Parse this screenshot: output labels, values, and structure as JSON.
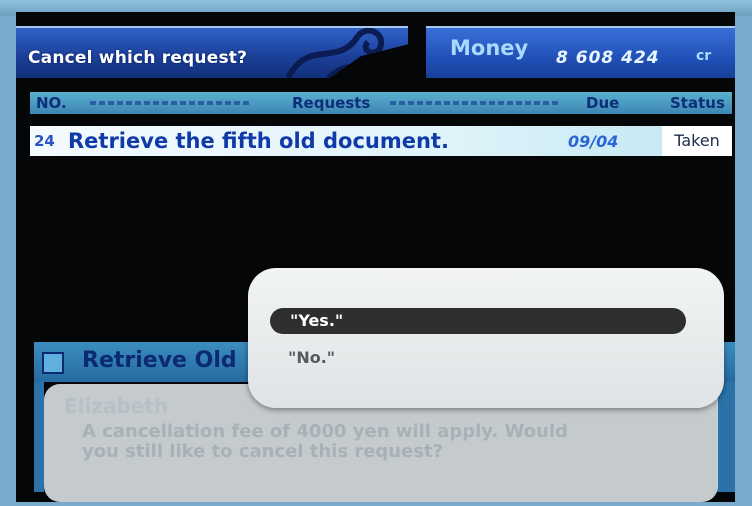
{
  "header": {
    "prompt": "Cancel which request?",
    "money_label": "Money",
    "money_value": "8 608 424",
    "money_unit": "cr"
  },
  "table": {
    "columns": [
      "NO.",
      "Requests",
      "Due",
      "Status"
    ],
    "rows": [
      {
        "no": "24",
        "request": "Retrieve the fifth old document.",
        "due": "09/04",
        "status": "Taken"
      }
    ]
  },
  "detail": {
    "title": "Retrieve Old"
  },
  "message": {
    "speaker": "Elizabeth",
    "text": "A cancellation fee of 4000 yen will apply. Would you still like to cancel this request?"
  },
  "choices": [
    {
      "label": "\"Yes.\"",
      "selected": true
    },
    {
      "label": "\"No.\"",
      "selected": false
    }
  ],
  "colors": {
    "header_blue": "#2150b8",
    "row_text": "#0f3aa8",
    "selected_choice": "#2f2f2f"
  }
}
